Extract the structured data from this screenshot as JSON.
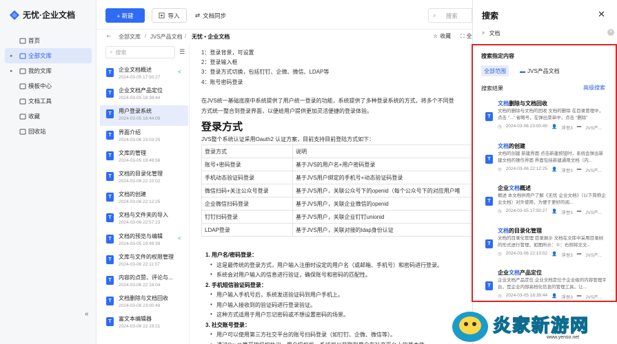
{
  "app": {
    "logo_text": "无忧·企业文档"
  },
  "nav": {
    "items": [
      {
        "label": "首页",
        "icon": "home-icon",
        "caret": ""
      },
      {
        "label": "全部文库",
        "icon": "folder-icon",
        "caret": "▸",
        "active": true
      },
      {
        "label": "我的文库",
        "icon": "folder-icon",
        "caret": "▸"
      },
      {
        "label": "模板中心",
        "icon": "template-icon",
        "caret": ""
      },
      {
        "label": "文档工具",
        "icon": "toolbox-icon",
        "caret": ""
      },
      {
        "label": "收藏",
        "icon": "star-icon",
        "caret": ""
      },
      {
        "label": "回收站",
        "icon": "trash-icon",
        "caret": ""
      }
    ],
    "collapse": "«"
  },
  "toolbar": {
    "new_label": "+ 新建",
    "import_label": "导入",
    "sync_label": "文档同步",
    "search_placeholder": "搜索"
  },
  "breadcrumb": {
    "items": [
      "全部文库",
      "JVS产品文档",
      "无忧 • 企业文档"
    ],
    "favorite": "收藏",
    "full": "全"
  },
  "list": {
    "search_placeholder": "搜索",
    "items": [
      {
        "title": "企业文档概述",
        "date": "2024-03-05 17:50:27",
        "share": true
      },
      {
        "title": "企业文档产品定位",
        "date": "2024-03-05 18:38:44"
      },
      {
        "title": "用户登录系统",
        "date": "2024-03-05 18:44:09",
        "selected": true
      },
      {
        "title": "界面介绍",
        "date": "2024-03-06 23:03:25"
      },
      {
        "title": "文库的管理",
        "date": "2024-03-05 19:48:56"
      },
      {
        "title": "文档的目录化管理",
        "date": "2024-03-06 22:10:02"
      },
      {
        "title": "文档的创建",
        "date": "2024-03-06 22:12:25"
      },
      {
        "title": "文档与文件夹的导入",
        "date": "2024-03-06 22:57:23"
      },
      {
        "title": "文档的预览与编辑",
        "date": "2024-03-05 19:49:39",
        "share": true
      },
      {
        "title": "文库与文件的权限管理",
        "date": "2024-03-06 22:11:07"
      },
      {
        "title": "内容的点赞、评论与...",
        "date": "2024-03-06 22:18:04"
      },
      {
        "title": "文档删除与文档回收",
        "date": "2024-03-06 23:00:49"
      },
      {
        "title": "富文本编辑器",
        "date": "2024-03-06 22:19:21"
      }
    ]
  },
  "doc": {
    "steps": [
      "1：登录背景，可设置",
      "2：登录输入框",
      "3：登录方式切换，包括钉钉、企微、微信、LDAP等",
      "4：账号密码登录"
    ],
    "intro1": "在JVS统一基础底座中系统提供了用户统一登录的功能，系统提供了多种登录系统的方式，将多个不同登",
    "intro2": "方式统一整合到登录界面，以便给用户提供更加灵活便捷的登录体验。",
    "heading": "登录方式",
    "support": "JVS整个系统认证采用Oauth2 认证方案，目前支持目前登陆方式如下：",
    "table_header": [
      "登录方式",
      "说明"
    ],
    "table_rows": [
      [
        "账号+密码登录",
        "基于JVS的用户名+用户密码登录"
      ],
      [
        "手机动态验证码登录",
        "基于JVS用户绑定的手机号+动态验证码登录"
      ],
      [
        "微信扫码+关注公众号登录",
        "基于JVS用户，关联公众号下的openid（每个公众号下的对应用户唯"
      ],
      [
        "企业微信扫码登录",
        "基于JVS用户，关联企业微信的openid"
      ],
      [
        "钉钉扫码登录",
        "基于JVS用户，关联企业钉钉unionid"
      ],
      [
        "LDAP登录",
        "基于JVS用户，关联对接的ldap身份认证"
      ]
    ],
    "sec1": "1. 用户名/密码登录：",
    "sec1_items": [
      "这是最传统的登录方式，用户输入注册时设定的用户名（或邮箱、手机号）和密码进行登录。",
      "系统会对用户输入的信息进行验证，确保账号和密码的匹配性。"
    ],
    "sec2": "2. 手机短信验证码登录：",
    "sec2_items": [
      "用户输入手机号后，系统发送验证码到用户手机上。",
      "用户输入接收到的验证码进行登录验证。",
      "这种方式适用于用户忘记密码或不想设置密码的场景。"
    ],
    "sec3": "3. 社交账号登录：",
    "sec3_items": [
      "用户可以使用第三方社交平台的账号扫码登录（如钉钉、企微、微信等）。",
      "通过Oauth等开放授权协议，用户授权后，系统可以获取到用户在社交平台上的基本信"
    ]
  },
  "panel": {
    "title": "搜索",
    "close": "✕",
    "query": "文档",
    "scope_heading": "搜索指定内容",
    "scope_all": "全部范围",
    "scope_jvs": "JVS产品文档",
    "results_heading": "搜索结果",
    "advanced": "高级搜索",
    "results": [
      {
        "title_pre": "",
        "title_hl": "文档",
        "title_post": "删除与文档回收",
        "snippet": "文档的删除与文档的回收 文档的删除 在目录管理中，点击 \"...\" 省略号，在弹出菜单中，点击 \"删除\"",
        "date": "2024-03-06 23:00:49",
        "author": "浮世3",
        "lib": "JVS产..."
      },
      {
        "title_pre": "",
        "title_hl": "文档",
        "title_post": "的创建",
        "snippet": "文档的创建 新建界面 点击新建按钮时，系统会弹出新建文档的操作界面 界面包括新建通用文档（内...",
        "date": "2024-03-06 22:12:25",
        "author": "浮世3",
        "lib": "JVS产..."
      },
      {
        "title_pre": "企业",
        "title_hl": "文档",
        "title_post": "概述",
        "snippet": "概述 本文档供用户了解《无忧·企业文档》（以下简称企业文档）对外使用，为便于更好的阅...",
        "date": "2024-03-05 17:50:27",
        "author": "浮世3",
        "lib": "JVS产..."
      },
      {
        "title_pre": "",
        "title_hl": "文档",
        "title_post": "的目录化管理",
        "snippet": "文档的目录化管理 目录展示 文档在文库中采用目录树的形式进行管理，如图所示：①：右侧将文文...",
        "date": "2024-03-06 22:10:02",
        "author": "浮世3",
        "lib": "JVS产..."
      },
      {
        "title_pre": "企业",
        "title_hl": "文档",
        "title_post": "产品定位",
        "snippet": "企业文档产品定位 企业文档定位于企业级的内容管理平台，是企业内部高档化信息的管理工具，让...",
        "date": "2024-03-05 18:38:44",
        "author": "浮世3",
        "lib": "JVS产..."
      }
    ]
  },
  "watermark": {
    "text": "炎家新游网",
    "url": "www.yenso.net"
  }
}
